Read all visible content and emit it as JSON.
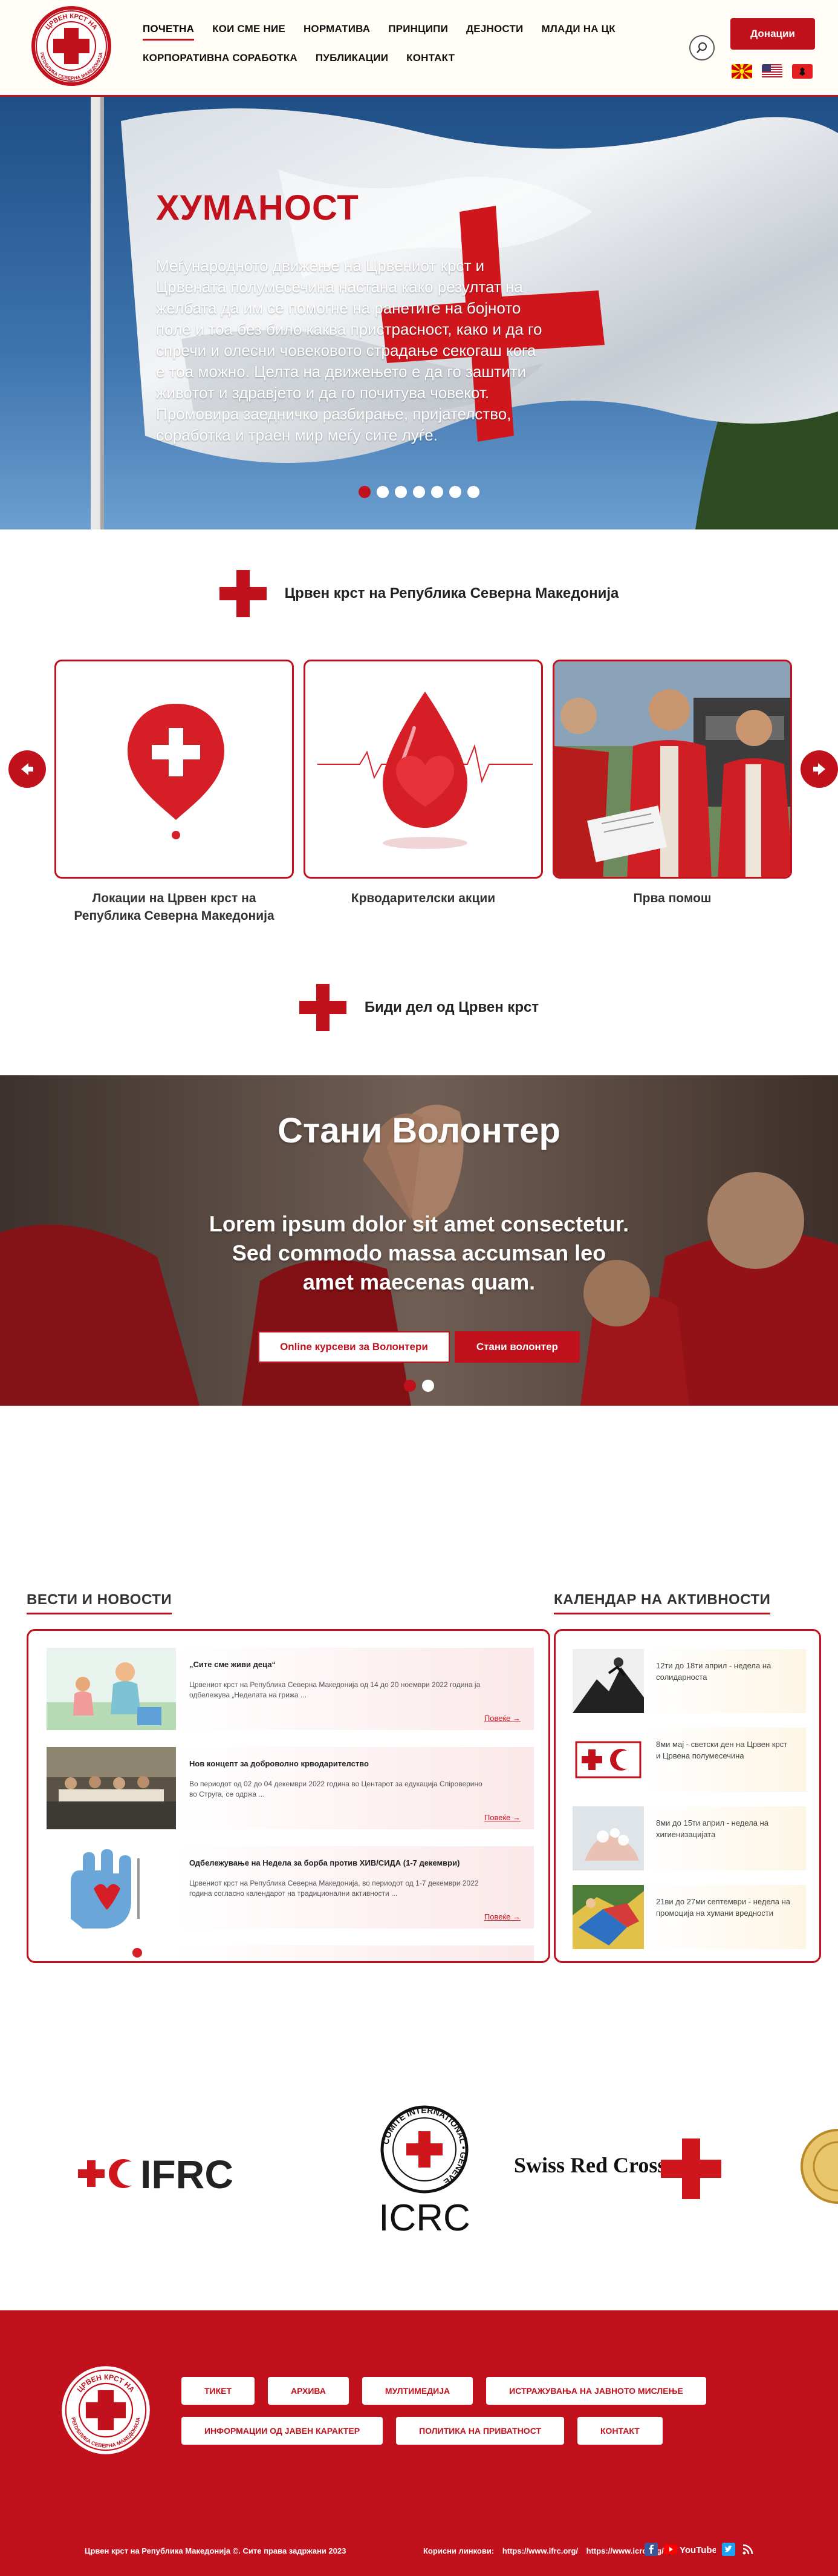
{
  "header": {
    "nav_row1": [
      "ПОЧЕТНА",
      "КОИ СМЕ НИЕ",
      "НОРМАТИВА",
      "ПРИНЦИПИ",
      "ДЕЈНОСТИ",
      "МЛАДИ НА ЦК"
    ],
    "nav_row2": [
      "КОРПОРАТИВНА СОРАБОТКА",
      "ПУБЛИКАЦИИ",
      "КОНТАКТ"
    ],
    "active_nav": "ПОЧЕТНА",
    "donate_label": "Донации",
    "logo_text_top": "ЦРВЕН КРСТ НА",
    "logo_text_bottom": "РЕПУБЛИКА СЕВЕРНА МАКЕДОНИЈА"
  },
  "hero": {
    "title": "ХУМАНОСТ",
    "text": "Меѓународното движење на Црвениот крст и Црвената полумесечина настана како резултат на желбата да им се помогне на ранетите на бојното поле и тоа без било каква пристрасност, како и да го спречи и олесни човековото страдање секогаш кога е тоа можно. Целта на движењето е да го заштити животот и здравјето и да го почитува човекот. Промовира заедничко разбирање, пријателство, соработка и траен мир меѓу сите луѓе.",
    "slide_count": 7,
    "active_slide": 1
  },
  "section1": {
    "title": "Црвен крст на Република Северна Македонија"
  },
  "cards": [
    {
      "label": "Локации на Црвен крст на Република Северна Македонија"
    },
    {
      "label": "Крводарителски акции"
    },
    {
      "label": "Прва помош"
    }
  ],
  "section2": {
    "title": "Биди дел од Црвен крст"
  },
  "volunteer": {
    "title": "Стани Волонтер",
    "text": "Lorem ipsum dolor sit amet consectetur. Sed commodo massa accumsan leo amet maecenas quam.",
    "btn_courses": "Online курсеви за Волонтери",
    "btn_volunteer": "Стани волонтер",
    "slide_count": 2,
    "active_slide": 2
  },
  "news": {
    "heading": "ВЕСТИ И НОВОСТИ",
    "more_label": "Повеќе →",
    "items": [
      {
        "title": "„Сите сме живи деца“",
        "excerpt": "Црвениот крст на Република Северна Македонија од 14 до 20 ноември 2022 година ја одбележува „Неделата на грижа ..."
      },
      {
        "title": "Нов концепт за доброволно крводарителство",
        "excerpt": "Во периодот од 02 до 04 декември 2022 година во Центарот за едукација Спiроверино во Струга, се одржа ..."
      },
      {
        "title": "Одбележување на Недела за борба против ХИВ/СИДА (1-7 декември)",
        "excerpt": "Црвениот крст на Република Северна Македонија, во периодот од 1-7 декември 2022 година согласно календарот на традиционални активности ..."
      }
    ]
  },
  "calendar": {
    "heading": "КАЛЕНДАР НА АКТИВНОСТИ",
    "items": [
      {
        "text": "12ти до 18ти април - недела на солидарноста"
      },
      {
        "text": "8ми мај - светски ден на Црвен крст и Црвена полумесечина"
      },
      {
        "text": "8ми до 15ти април - недела на хигиенизацијата"
      },
      {
        "text": "21ви до 27ми септември - недела на промоција на хумани вредности"
      }
    ]
  },
  "partners": {
    "ifrc": "IFRC",
    "icrc": "ICRC",
    "icrc_ring": "COMITE INTERNATIONAL • GENEVE",
    "swiss": "Swiss Red Cross"
  },
  "footer": {
    "links_row1": [
      "ТИКЕТ",
      "АРХИВА",
      "МУЛТИМЕДИЈА",
      "ИСТРАЖУВАЊА НА ЈАВНОТО МИСЛЕЊЕ"
    ],
    "links_row2": [
      "ИНФОРМАЦИИ ОД ЈАВЕН КАРАКТЕР",
      "ПОЛИТИКА НА ПРИВАТНОСТ",
      "КОНТАКТ"
    ],
    "copyright": "Црвен крст на Република Македонија ©. Сите права задржани 2023",
    "useful_label": "Корисни линкови:",
    "useful_links": [
      "https://www.ifrc.org/",
      "https://www.icrc.org/"
    ],
    "youtube_label": "YouTube"
  },
  "colors": {
    "brand_red": "#c0111c",
    "header_bg": "#fffdf6"
  }
}
